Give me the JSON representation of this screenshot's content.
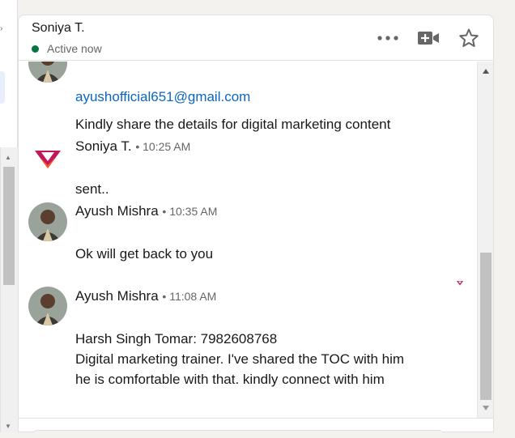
{
  "header": {
    "contact_name": "Soniya T.",
    "status_text": "Active now",
    "status_color": "#057642",
    "icons": [
      "more-options-icon",
      "video-call-icon",
      "star-icon"
    ]
  },
  "messages": [
    {
      "link_text": "ayushofficial651@gmail.com",
      "text": "Kindly share the details for digital marketing content"
    },
    {
      "sender": "Soniya T.",
      "time": "• 10:25 AM",
      "text": "sent.."
    },
    {
      "sender": "Ayush Mishra",
      "time": "• 10:35 AM",
      "text": "Ok will get back to you"
    },
    {
      "sender": "Ayush Mishra",
      "time": "• 11:08 AM",
      "lines": [
        "Harsh Singh Tomar: 7982608768",
        "Digital marketing trainer. I've shared the TOC with him",
        "he is comfortable with that. kindly connect with him"
      ]
    }
  ],
  "colors": {
    "link": "#0a66c2",
    "logo_top": "#c2185b",
    "logo_bottom": "#ff5722"
  }
}
